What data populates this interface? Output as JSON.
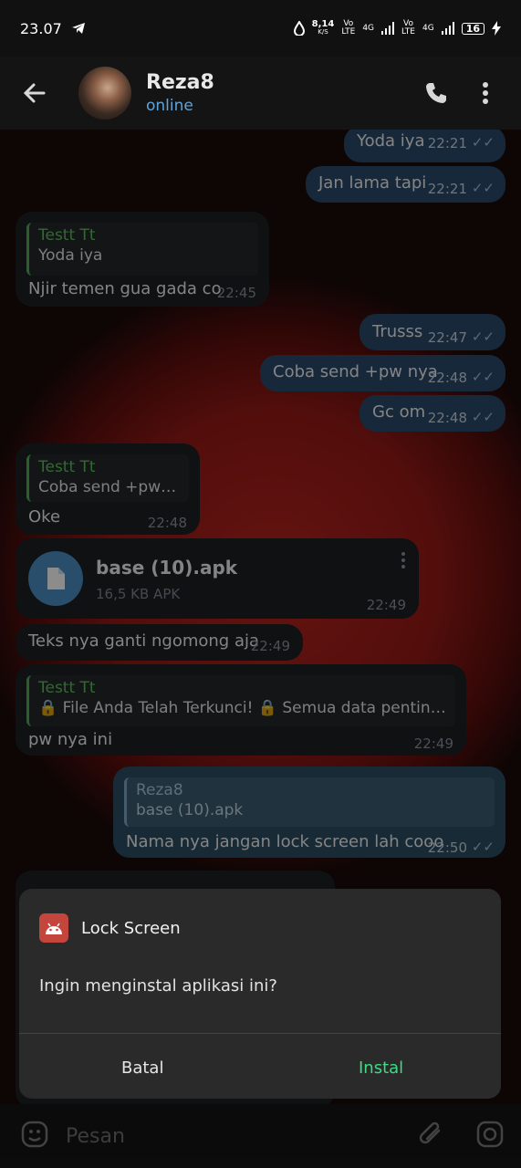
{
  "status_bar": {
    "time": "23.07",
    "net_speed": "8,14",
    "net_unit": "K/S",
    "sim1_top": "Vo",
    "sim1_bottom": "LTE",
    "sim1_net": "4G",
    "sim2_top": "Vo",
    "sim2_bottom": "LTE",
    "sim2_net": "4G",
    "battery": "16"
  },
  "header": {
    "name": "Reza8",
    "status": "online"
  },
  "messages": [
    {
      "text": "Yoda iya",
      "time": "22:21"
    },
    {
      "text": "Jan lama tapi",
      "time": "22:21"
    },
    {
      "reply_name": "Testt Tt",
      "reply_text": "Yoda iya",
      "text": "Njir temen gua gada co",
      "time": "22:45"
    },
    {
      "text": "Trusss",
      "time": "22:47"
    },
    {
      "text": "Coba send +pw nya",
      "time": "22:48"
    },
    {
      "text": "Gc om",
      "time": "22:48"
    },
    {
      "reply_name": "Testt Tt",
      "reply_text": "Coba send +pw nya",
      "text": "Oke",
      "time": "22:48"
    },
    {
      "file_name": "base (10).apk",
      "file_meta": "16,5 KB APK",
      "time": "22:49"
    },
    {
      "text": "Teks nya ganti ngomong aja",
      "time": "22:49"
    },
    {
      "reply_name": "Testt Tt",
      "reply_text": "🔒 File Anda Telah Terkunci! 🔒 Semua data penting And...",
      "text": "pw nya ini",
      "time": "22:49"
    },
    {
      "reply_name": "Reza8",
      "reply_text": "base (10).apk",
      "text": "Nama nya jangan lock screen lah cooo",
      "time": "22:50"
    }
  ],
  "dialog": {
    "app_name": "Lock Screen",
    "message": "Ingin menginstal aplikasi ini?",
    "cancel": "Batal",
    "install": "Instal"
  },
  "input": {
    "placeholder": "Pesan"
  },
  "colors": {
    "outgoing_bubble": "#2a4a6a",
    "incoming_bubble": "#1c1f24",
    "reply_accent": "#4caf50",
    "install_button": "#3ddc84",
    "online_status": "#5fa3d8"
  }
}
